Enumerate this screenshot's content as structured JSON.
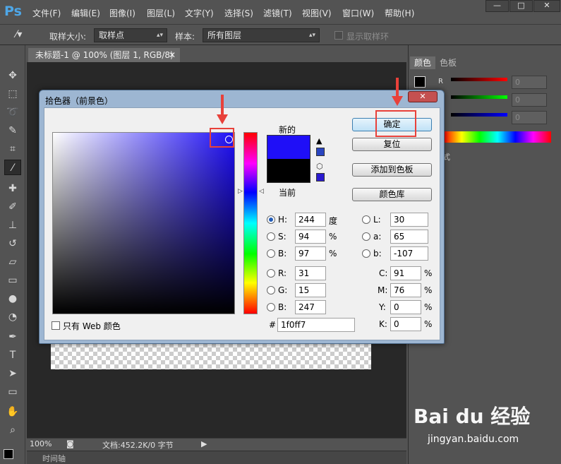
{
  "app": {
    "logo": "Ps",
    "menu": [
      "文件(F)",
      "编辑(E)",
      "图像(I)",
      "图层(L)",
      "文字(Y)",
      "选择(S)",
      "滤镜(T)",
      "视图(V)",
      "窗口(W)",
      "帮助(H)"
    ],
    "window_controls": [
      "—",
      "□",
      "✕"
    ]
  },
  "options_bar": {
    "sample_size_label": "取样大小:",
    "sample_size_value": "取样点",
    "sample_label": "样本:",
    "sample_value": "所有图层",
    "show_ring_label": "显示取样环"
  },
  "document": {
    "tab_title": "未标题-1 @ 100% (图层 1, RGB/8)",
    "tab_close": "✕",
    "zoom": "100%",
    "doc_info": "文档:452.2K/0 字节",
    "timeline_label": "时间轴"
  },
  "right_panel": {
    "tabs": [
      "颜色",
      "色板"
    ],
    "channel_r": "R",
    "value_r": "0",
    "value_g": "0",
    "value_b": "0",
    "second_panel_tab": "式"
  },
  "dialog": {
    "title": "拾色器（前景色）",
    "close": "✕",
    "new_label": "新的",
    "current_label": "当前",
    "new_color": "#1f0ff7",
    "current_color": "#000000",
    "buttons": {
      "ok": "确定",
      "reset": "复位",
      "add_swatch": "添加到色板",
      "color_library": "颜色库"
    },
    "hsb": {
      "h_label": "H:",
      "h_value": "244",
      "h_unit": "度",
      "s_label": "S:",
      "s_value": "94",
      "s_unit": "%",
      "b_label": "B:",
      "b_value": "97",
      "b_unit": "%"
    },
    "rgb": {
      "r_label": "R:",
      "r_value": "31",
      "g_label": "G:",
      "g_value": "15",
      "b_label": "B:",
      "b_value": "247"
    },
    "lab": {
      "l_label": "L:",
      "l_value": "30",
      "a_label": "a:",
      "a_value": "65",
      "b_label": "b:",
      "b_value": "-107"
    },
    "cmyk": {
      "c_label": "C:",
      "c_value": "91",
      "m_label": "M:",
      "m_value": "76",
      "y_label": "Y:",
      "y_value": "0",
      "k_label": "K:",
      "k_value": "0",
      "unit": "%"
    },
    "hex_label": "#",
    "hex_value": "1f0ff7",
    "web_only_label": "只有 Web 颜色",
    "selected_mode": "H"
  },
  "watermark": {
    "brand": "Bai du 经验",
    "url": "jingyan.baidu.com"
  },
  "colors": {
    "annotation_red": "#e8413a",
    "selected_color": "#1f0ff7",
    "ui_background": "#535353"
  }
}
